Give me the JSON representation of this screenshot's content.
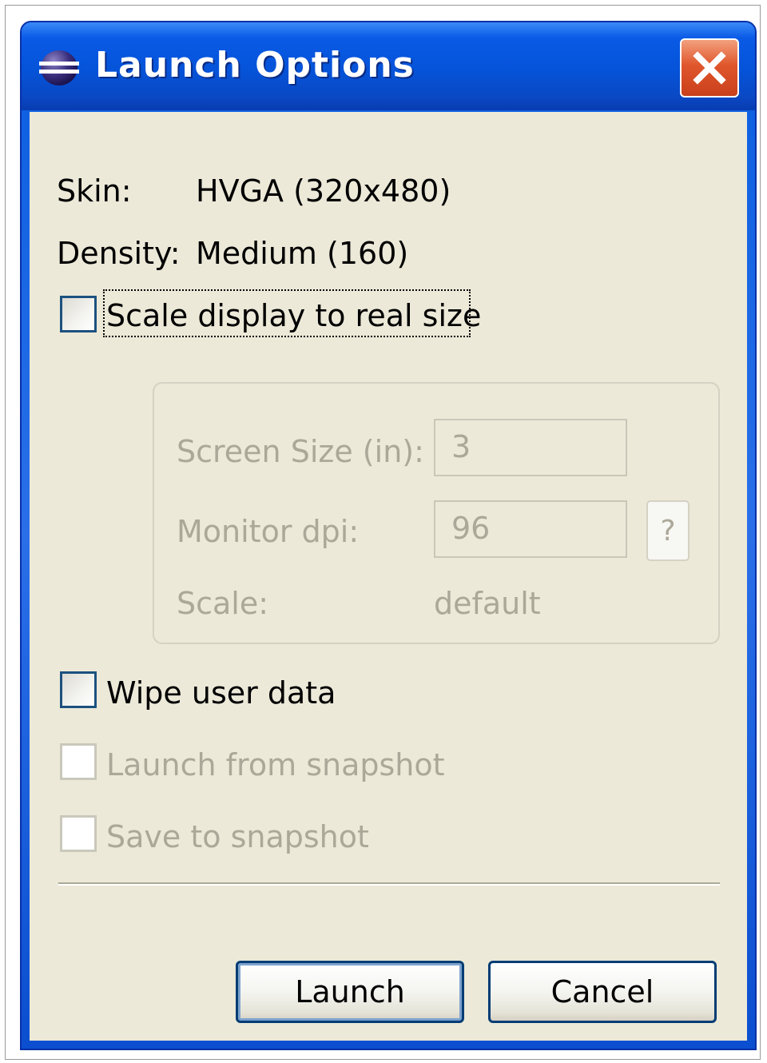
{
  "window": {
    "title": "Launch Options"
  },
  "icons": {
    "app": "eclipse-icon",
    "close": "close-icon"
  },
  "info": {
    "skin_label": "Skin:",
    "skin_value": "HVGA (320x480)",
    "density_label": "Density:",
    "density_value": "Medium (160)"
  },
  "scale_option": {
    "label": "Scale display to real size",
    "checked": false
  },
  "scale_group": {
    "screen_size_label": "Screen Size (in):",
    "screen_size_value": "3",
    "monitor_dpi_label": "Monitor dpi:",
    "monitor_dpi_value": "96",
    "help_label": "?",
    "scale_label": "Scale:",
    "scale_value": "default"
  },
  "options": {
    "wipe_label": "Wipe user data",
    "wipe_checked": false,
    "launch_snapshot_label": "Launch from snapshot",
    "save_snapshot_label": "Save to snapshot"
  },
  "buttons": {
    "launch": "Launch",
    "cancel": "Cancel"
  },
  "colors": {
    "titlebar": "#0553d8",
    "close": "#e0562c",
    "client_bg": "#ece9d8",
    "disabled_text": "#aca899"
  }
}
